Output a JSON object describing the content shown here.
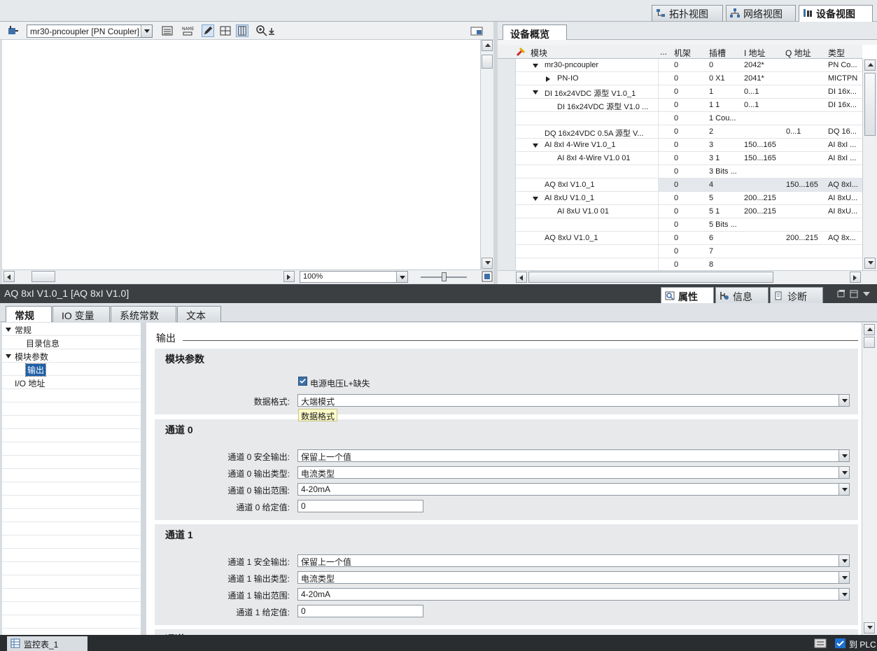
{
  "view_tabs": [
    {
      "label": "拓扑视图",
      "icon": "topology-view-icon"
    },
    {
      "label": "网络视图",
      "icon": "network-view-icon"
    },
    {
      "label": "设备视图",
      "icon": "device-view-icon"
    }
  ],
  "editor": {
    "device_select": "mr30-pncoupler [PN Coupler]",
    "zoom": "100%"
  },
  "overview": {
    "tab": "设备概览",
    "columns": {
      "module": "模块",
      "more": "...",
      "rack": "机架",
      "slot": "插槽",
      "i_addr": "I 地址",
      "q_addr": "Q 地址",
      "type": "类型"
    },
    "rows": [
      {
        "expander": "down",
        "indent": 0,
        "module": "mr30-pncoupler",
        "rack": "0",
        "slot": "0",
        "i_addr": "2042*",
        "q_addr": "",
        "type": "PN Co..."
      },
      {
        "expander": "right",
        "indent": 1,
        "module": "PN-IO",
        "rack": "0",
        "slot": "0 X1",
        "i_addr": "2041*",
        "q_addr": "",
        "type": "MICTPN"
      },
      {
        "expander": "down",
        "indent": 0,
        "module": "DI 16x24VDC 源型 V1.0_1",
        "rack": "0",
        "slot": "1",
        "i_addr": "0...1",
        "q_addr": "",
        "type": "DI 16x..."
      },
      {
        "expander": "",
        "indent": 1,
        "module": "DI 16x24VDC 源型 V1.0 ...",
        "rack": "0",
        "slot": "1 1",
        "i_addr": "0...1",
        "q_addr": "",
        "type": "DI 16x..."
      },
      {
        "expander": "",
        "indent": 1,
        "module": "",
        "rack": "0",
        "slot": "1 Cou...",
        "i_addr": "",
        "q_addr": "",
        "type": ""
      },
      {
        "expander": "",
        "indent": 0,
        "module": "DQ 16x24VDC 0.5A 源型 V...",
        "rack": "0",
        "slot": "2",
        "i_addr": "",
        "q_addr": "0...1",
        "type": "DQ 16..."
      },
      {
        "expander": "down",
        "indent": 0,
        "module": "AI 8xI 4-Wire V1.0_1",
        "rack": "0",
        "slot": "3",
        "i_addr": "150...165",
        "q_addr": "",
        "type": "AI 8xI ..."
      },
      {
        "expander": "",
        "indent": 1,
        "module": "AI 8xI 4-Wire V1.0 01",
        "rack": "0",
        "slot": "3 1",
        "i_addr": "150...165",
        "q_addr": "",
        "type": "AI 8xI ..."
      },
      {
        "expander": "",
        "indent": 1,
        "module": "",
        "rack": "0",
        "slot": "3 Bits ...",
        "i_addr": "",
        "q_addr": "",
        "type": ""
      },
      {
        "expander": "",
        "indent": 0,
        "module": "AQ 8xI V1.0_1",
        "rack": "0",
        "slot": "4",
        "i_addr": "",
        "q_addr": "150...165",
        "type": "AQ 8xI...",
        "selected": true
      },
      {
        "expander": "down",
        "indent": 0,
        "module": "AI 8xU V1.0_1",
        "rack": "0",
        "slot": "5",
        "i_addr": "200...215",
        "q_addr": "",
        "type": "AI 8xU..."
      },
      {
        "expander": "",
        "indent": 1,
        "module": "AI 8xU V1.0 01",
        "rack": "0",
        "slot": "5 1",
        "i_addr": "200...215",
        "q_addr": "",
        "type": "AI 8xU..."
      },
      {
        "expander": "",
        "indent": 1,
        "module": "",
        "rack": "0",
        "slot": "5 Bits ...",
        "i_addr": "",
        "q_addr": "",
        "type": ""
      },
      {
        "expander": "",
        "indent": 0,
        "module": "AQ 8xU V1.0_1",
        "rack": "0",
        "slot": "6",
        "i_addr": "",
        "q_addr": "200...215",
        "type": "AQ 8x..."
      },
      {
        "expander": "",
        "indent": 0,
        "module": "",
        "rack": "0",
        "slot": "7",
        "i_addr": "",
        "q_addr": "",
        "type": ""
      },
      {
        "expander": "",
        "indent": 0,
        "module": "",
        "rack": "0",
        "slot": "8",
        "i_addr": "",
        "q_addr": "",
        "type": ""
      }
    ]
  },
  "properties": {
    "title": "AQ 8xI V1.0_1 [AQ 8xI V1.0]",
    "tabs": [
      "属性",
      "信息",
      "诊断"
    ],
    "sub_tabs": [
      "常规",
      "IO 变量",
      "系统常数",
      "文本"
    ],
    "nav": [
      {
        "label": "常规",
        "level": 0,
        "expander": "down"
      },
      {
        "label": "目录信息",
        "level": 1
      },
      {
        "label": "模块参数",
        "level": 0,
        "expander": "down"
      },
      {
        "label": "输出",
        "level": 1,
        "selected": true
      },
      {
        "label": "I/O 地址",
        "level": 0
      }
    ],
    "section_title": "输出",
    "module_params": {
      "title": "模块参数",
      "power_check_label": "电源电压L+缺失",
      "data_format_label": "数据格式:",
      "data_format_value": "大端模式",
      "tooltip": "数据格式"
    },
    "channels": [
      {
        "title": "通道 0",
        "safe_label": "通道 0 安全输出:",
        "safe_value": "保留上一个值",
        "type_label": "通道 0 输出类型:",
        "type_value": "电流类型",
        "range_label": "通道 0 输出范围:",
        "range_value": "4-20mA",
        "set_label": "通道 0 给定值:",
        "set_value": "0"
      },
      {
        "title": "通道 1",
        "safe_label": "通道 1 安全输出:",
        "safe_value": "保留上一个值",
        "type_label": "通道 1 输出类型:",
        "type_value": "电流类型",
        "range_label": "通道 1 输出范围:",
        "range_value": "4-20mA",
        "set_label": "通道 1 给定值:",
        "set_value": "0"
      }
    ],
    "next_group_title": "通道"
  },
  "statusbar": {
    "task": "监控表_1",
    "right": "到 PLC"
  }
}
